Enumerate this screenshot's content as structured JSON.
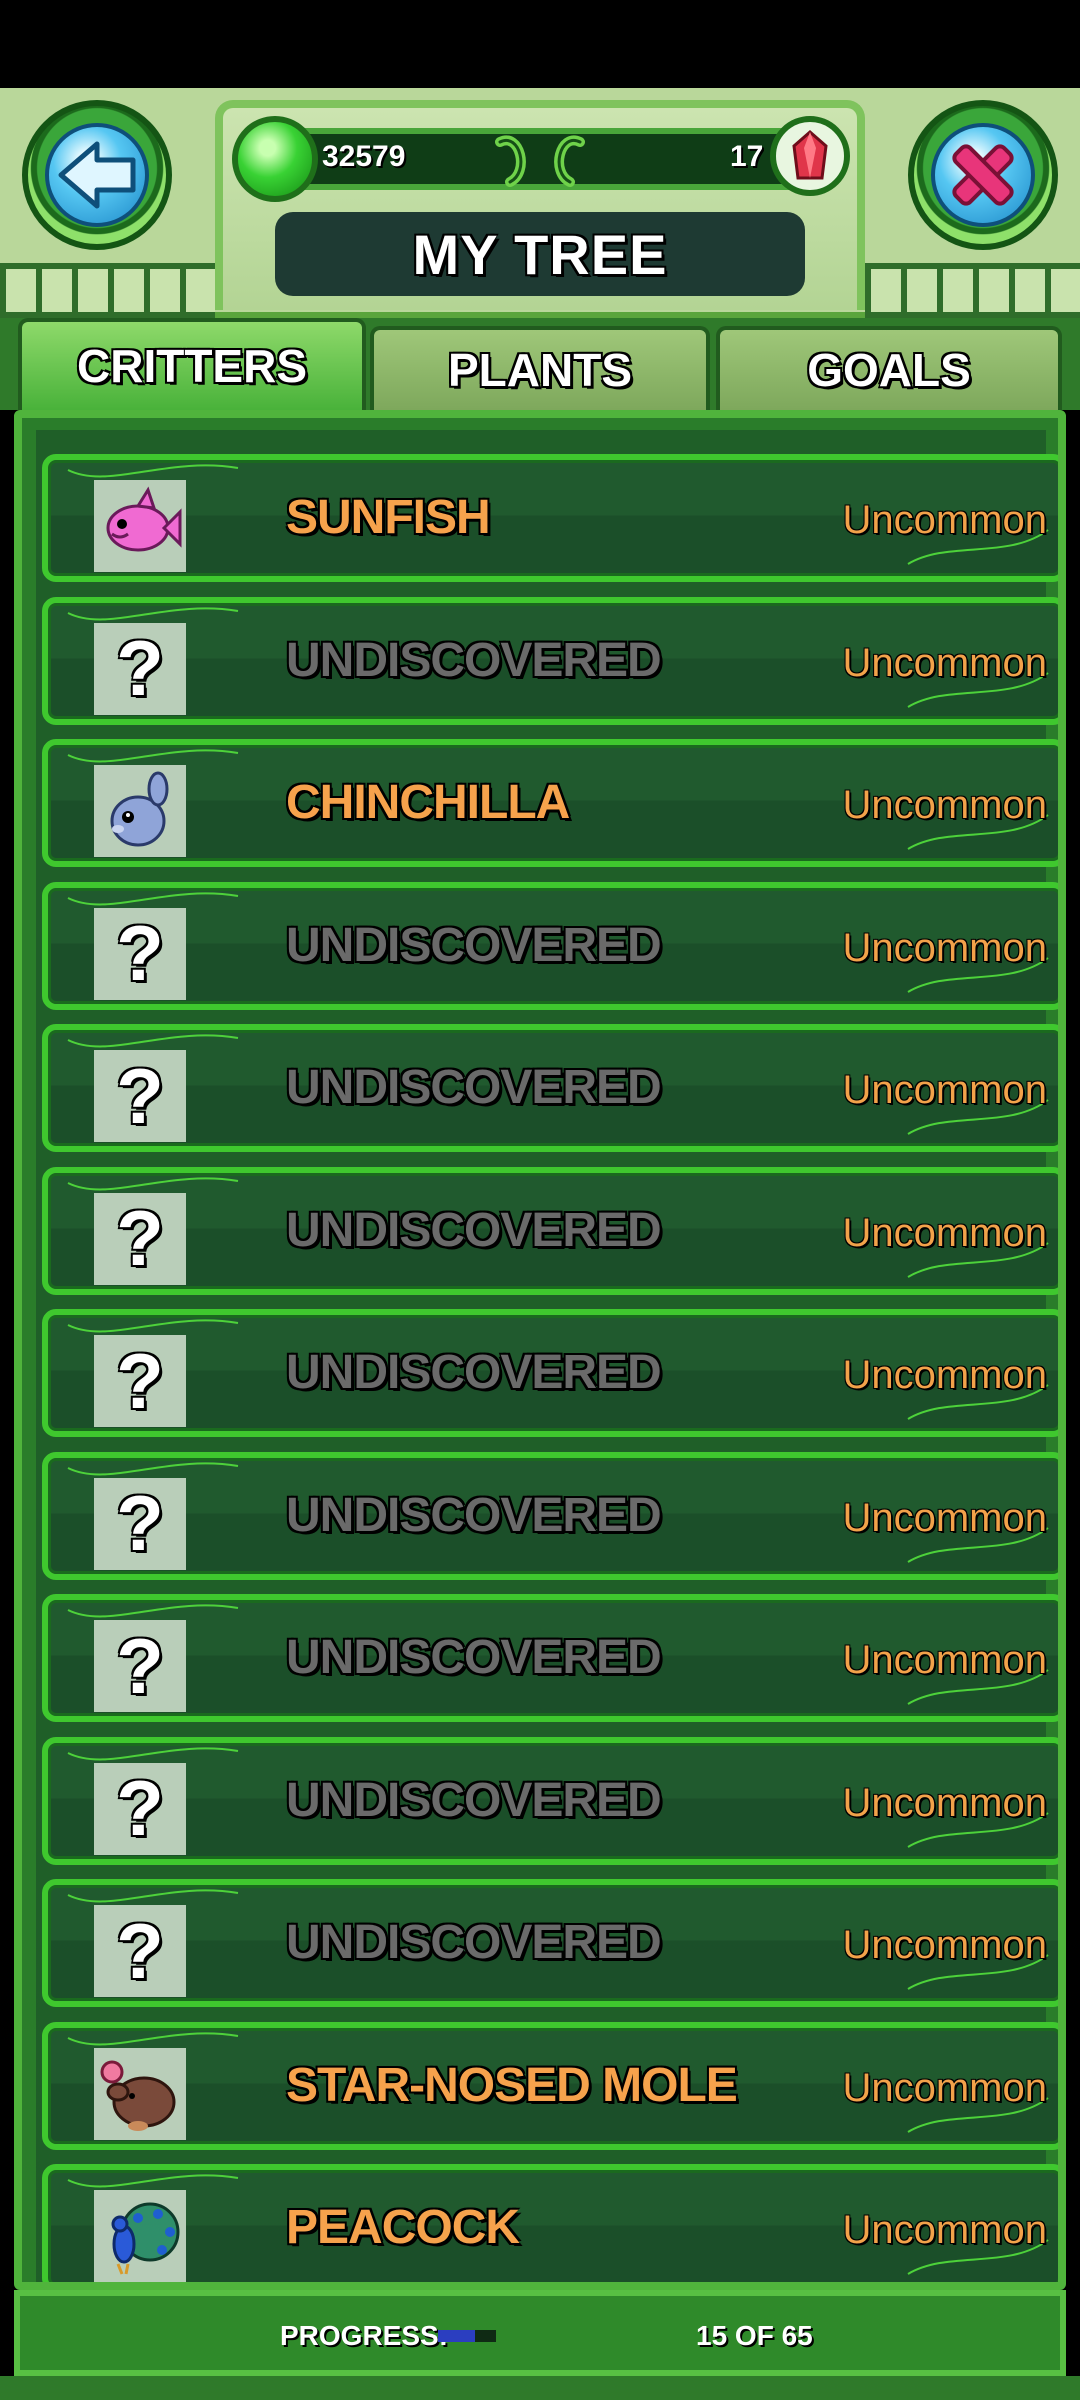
{
  "header": {
    "title": "MY TREE",
    "green_currency": "32579",
    "red_currency": "17",
    "back_icon": "back-arrow-icon",
    "close_icon": "close-x-icon"
  },
  "tabs": [
    {
      "label": "CRITTERS",
      "active": true
    },
    {
      "label": "PLANTS",
      "active": false
    },
    {
      "label": "GOALS",
      "active": false
    }
  ],
  "list": {
    "items": [
      {
        "name": "SUNFISH",
        "rarity": "Uncommon",
        "discovered": true,
        "icon": "sunfish-icon"
      },
      {
        "name": "UNDISCOVERED",
        "rarity": "Uncommon",
        "discovered": false,
        "icon": "question-mark-icon"
      },
      {
        "name": "CHINCHILLA",
        "rarity": "Uncommon",
        "discovered": true,
        "icon": "chinchilla-icon"
      },
      {
        "name": "UNDISCOVERED",
        "rarity": "Uncommon",
        "discovered": false,
        "icon": "question-mark-icon"
      },
      {
        "name": "UNDISCOVERED",
        "rarity": "Uncommon",
        "discovered": false,
        "icon": "question-mark-icon"
      },
      {
        "name": "UNDISCOVERED",
        "rarity": "Uncommon",
        "discovered": false,
        "icon": "question-mark-icon"
      },
      {
        "name": "UNDISCOVERED",
        "rarity": "Uncommon",
        "discovered": false,
        "icon": "question-mark-icon"
      },
      {
        "name": "UNDISCOVERED",
        "rarity": "Uncommon",
        "discovered": false,
        "icon": "question-mark-icon"
      },
      {
        "name": "UNDISCOVERED",
        "rarity": "Uncommon",
        "discovered": false,
        "icon": "question-mark-icon"
      },
      {
        "name": "UNDISCOVERED",
        "rarity": "Uncommon",
        "discovered": false,
        "icon": "question-mark-icon"
      },
      {
        "name": "UNDISCOVERED",
        "rarity": "Uncommon",
        "discovered": false,
        "icon": "question-mark-icon"
      },
      {
        "name": "STAR-NOSED MOLE",
        "rarity": "Uncommon",
        "discovered": true,
        "icon": "star-nosed-mole-icon"
      },
      {
        "name": "PEACOCK",
        "rarity": "Uncommon",
        "discovered": true,
        "icon": "peacock-icon"
      }
    ]
  },
  "footer": {
    "progress_label": "PROGRESS:",
    "progress_count": "15 OF 65",
    "progress_fraction": 0.2308
  },
  "colors": {
    "found_name": "#f6a24c",
    "unknown_name": "#6a6a6a",
    "rarity": "#f2a24a",
    "row_border": "#3fc82e",
    "progress_fill": "#2b3ec0"
  }
}
